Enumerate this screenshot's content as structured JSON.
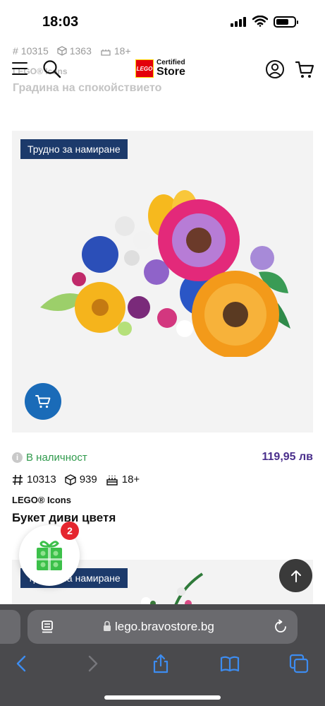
{
  "status_bar": {
    "time": "18:03",
    "battery_level": 0.7
  },
  "ghost_product": {
    "number": "10315",
    "pieces": "1363",
    "age": "18+",
    "brand": "LEGO® Icons",
    "title": "Градина на спокойствието"
  },
  "header": {
    "logo_brand": "LEGO",
    "logo_line1": "Certified",
    "logo_line2": "Store"
  },
  "product": {
    "badge": "Трудно за намиране",
    "stock": "В наличност",
    "price": "119,95 лв",
    "number": "10313",
    "pieces": "939",
    "age": "18+",
    "brand": "LEGO® Icons",
    "title": "Букет диви цветя"
  },
  "next_product": {
    "badge": "Трудно за намиране"
  },
  "gift": {
    "count": "2"
  },
  "browser": {
    "url": "lego.bravostore.bg"
  },
  "colors": {
    "badge_bg": "#1c3a6b",
    "cart_button": "#1a6bb8",
    "stock_green": "#2f9a4c",
    "price_purple": "#4a2f8c",
    "gift_green": "#3cc04a",
    "gift_badge_red": "#e5262f",
    "safari_bar": "#4a4a4d",
    "safari_icon_blue": "#3d8cf0"
  }
}
